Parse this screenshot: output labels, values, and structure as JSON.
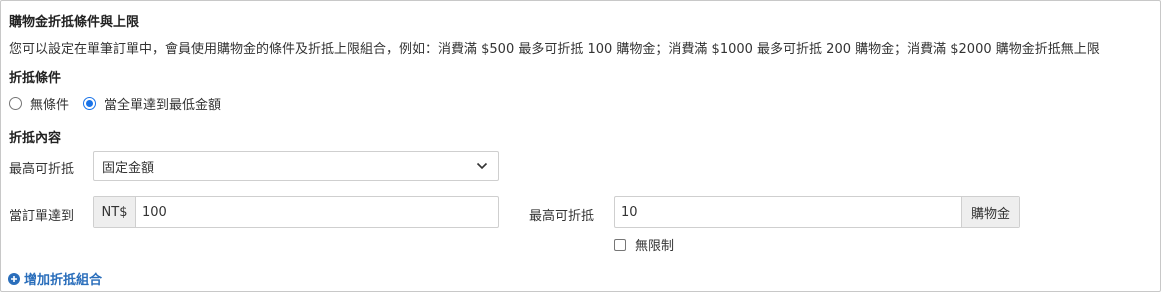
{
  "section": {
    "title": "購物金折抵條件與上限",
    "description": "您可以設定在單筆訂單中，會員使用購物金的條件及折抵上限組合，例如：消費滿 $500 最多可折抵 100 購物金；消費滿 $1000 最多可折抵 200 購物金；消費滿 $2000 購物金折抵無上限"
  },
  "condition": {
    "heading": "折抵條件",
    "options": [
      {
        "label": "無條件",
        "checked": false
      },
      {
        "label": "當全單達到最低金額",
        "checked": true
      }
    ]
  },
  "content": {
    "heading": "折抵內容",
    "max_label": "最高可折抵",
    "max_type_value": "固定金額",
    "order_reach_label": "當訂單達到",
    "currency_prefix": "NT$",
    "order_amount_value": "100",
    "max_deduct_label": "最高可折抵",
    "max_deduct_value": "10",
    "points_suffix": "購物金",
    "unlimited_label": "無限制",
    "unlimited_checked": false
  },
  "add_combo_label": "增加折抵組合",
  "colors": {
    "link": "#2a6ebb",
    "radio_accent": "#1a73e8"
  }
}
